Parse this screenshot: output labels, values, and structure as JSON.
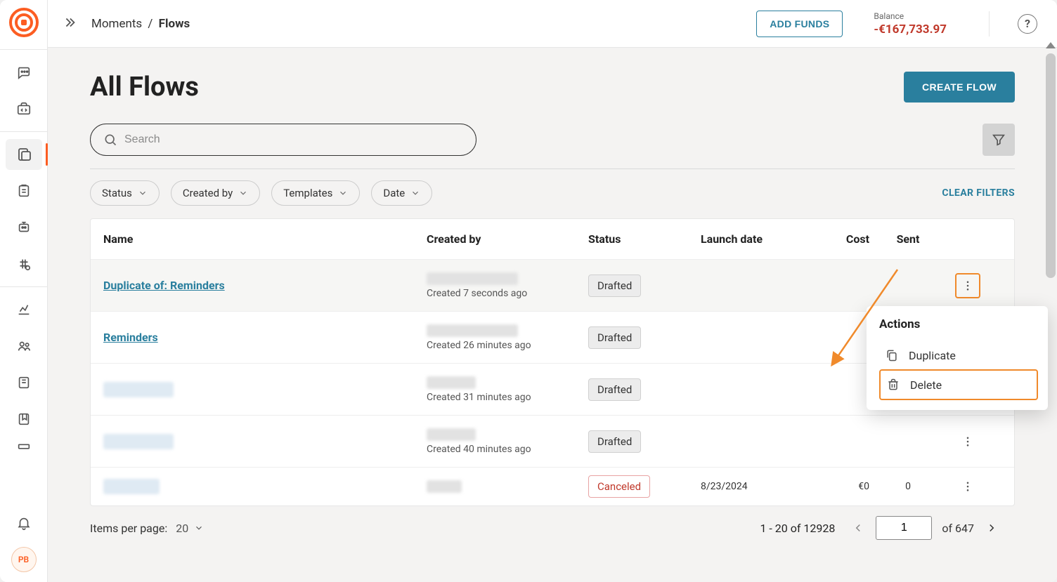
{
  "breadcrumb": {
    "parent": "Moments",
    "current": "Flows"
  },
  "topbar": {
    "add_funds": "ADD FUNDS",
    "balance_label": "Balance",
    "balance_amount": "-€167,733.97"
  },
  "page": {
    "title": "All Flows",
    "create_flow": "CREATE FLOW"
  },
  "search": {
    "placeholder": "Search"
  },
  "filters": {
    "status": "Status",
    "created_by": "Created by",
    "templates": "Templates",
    "date": "Date",
    "clear": "CLEAR FILTERS"
  },
  "table": {
    "headers": {
      "name": "Name",
      "created_by": "Created by",
      "status": "Status",
      "launch_date": "Launch date",
      "cost": "Cost",
      "sent": "Sent"
    },
    "rows": [
      {
        "name": "Duplicate of: Reminders",
        "created_ago": "Created 7 seconds ago",
        "status": "Drafted",
        "launch_date": "",
        "cost": "",
        "sent": ""
      },
      {
        "name": "Reminders",
        "created_ago": "Created 26 minutes ago",
        "status": "Drafted",
        "launch_date": "",
        "cost": "",
        "sent": ""
      },
      {
        "name": "",
        "created_ago": "Created 31 minutes ago",
        "status": "Drafted",
        "launch_date": "",
        "cost": "",
        "sent": ""
      },
      {
        "name": "",
        "created_ago": "Created 40 minutes ago",
        "status": "Drafted",
        "launch_date": "",
        "cost": "",
        "sent": ""
      },
      {
        "name": "",
        "created_ago": "",
        "status": "Canceled",
        "launch_date": "8/23/2024",
        "cost": "€0",
        "sent": "0"
      }
    ]
  },
  "actions_menu": {
    "title": "Actions",
    "duplicate": "Duplicate",
    "delete": "Delete"
  },
  "pagination": {
    "items_per_page_label": "Items per page:",
    "items_per_page_value": "20",
    "range": "1 - 20 of 12928",
    "page_input": "1",
    "page_total": "of 647"
  },
  "avatar": "PB"
}
